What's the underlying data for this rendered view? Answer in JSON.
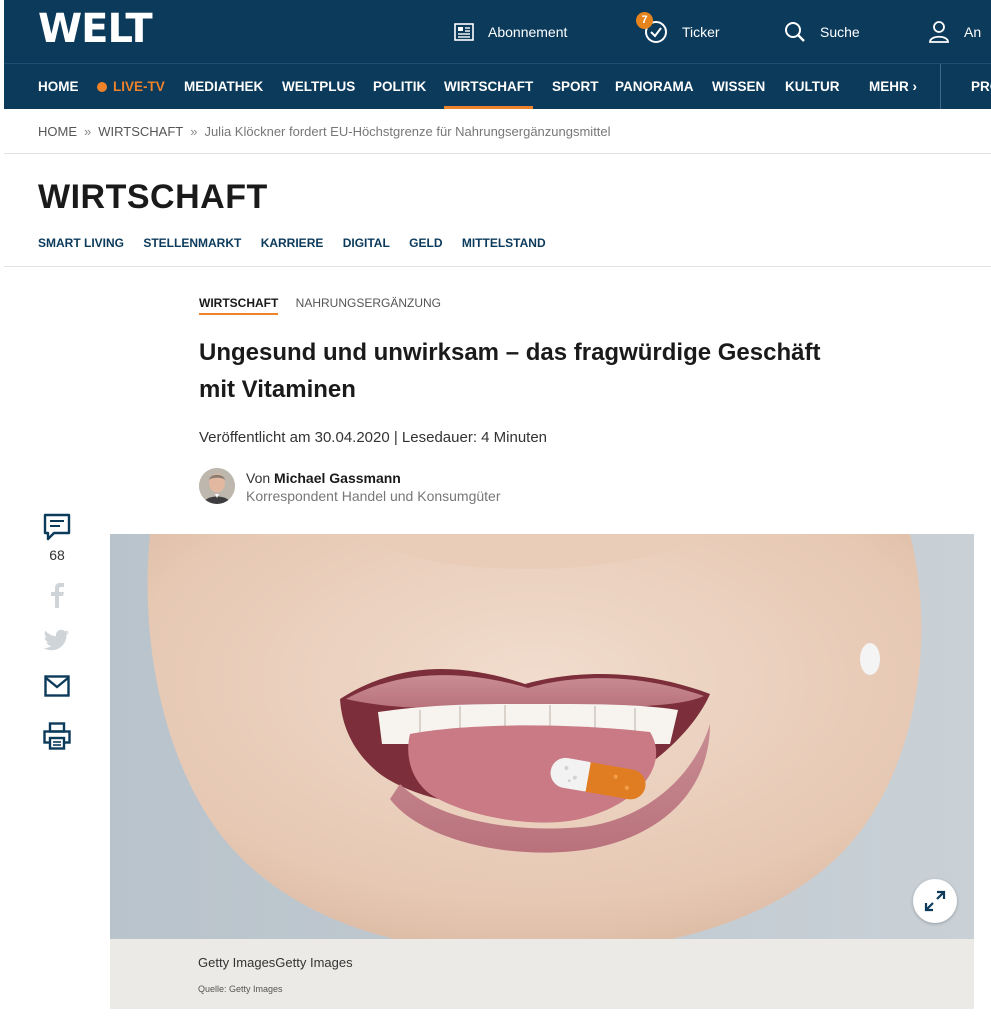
{
  "brand": {
    "logo_text": "WELT"
  },
  "top_actions": [
    {
      "label": "Abonnement",
      "icon": "newspaper-icon"
    },
    {
      "label": "Ticker",
      "icon": "ticker-clock-icon",
      "badge": "7"
    },
    {
      "label": "Suche",
      "icon": "search-icon"
    },
    {
      "label": "An",
      "icon": "user-icon"
    }
  ],
  "nav": {
    "items": [
      "HOME",
      "LIVE-TV",
      "MEDIATHEK",
      "WELTPLUS",
      "POLITIK",
      "WIRTSCHAFT",
      "SPORT",
      "PANORAMA",
      "WISSEN",
      "KULTUR",
      "MEHR"
    ],
    "right_cut": "PRO",
    "active": "WIRTSCHAFT"
  },
  "breadcrumb": {
    "home": "HOME",
    "section": "WIRTSCHAFT",
    "separator": "»",
    "current": "Julia Klöckner fordert EU-Höchstgrenze für Nahrungsergänzungsmittel"
  },
  "section": {
    "title": "WIRTSCHAFT",
    "subnav": [
      "SMART LIVING",
      "STELLENMARKT",
      "KARRIERE",
      "DIGITAL",
      "GELD",
      "MITTELSTAND"
    ]
  },
  "article": {
    "kicker_primary": "WIRTSCHAFT",
    "kicker_secondary": "NAHRUNGSERGÄNZUNG",
    "headline": "Ungesund und unwirksam – das fragwürdige Geschäft mit Vitaminen",
    "meta": "Veröffentlicht am 30.04.2020 | Lesedauer: 4 Minuten",
    "author_prefix": "Von",
    "author_name": "Michael Gassmann",
    "author_role": "Korrespondent Handel und Konsumgüter"
  },
  "share": {
    "comment_count": "68"
  },
  "image": {
    "caption": "Getty ImagesGetty Images",
    "source": "Quelle: Getty Images"
  },
  "colors": {
    "navy": "#0b3a5b",
    "accent": "#f0832a"
  }
}
